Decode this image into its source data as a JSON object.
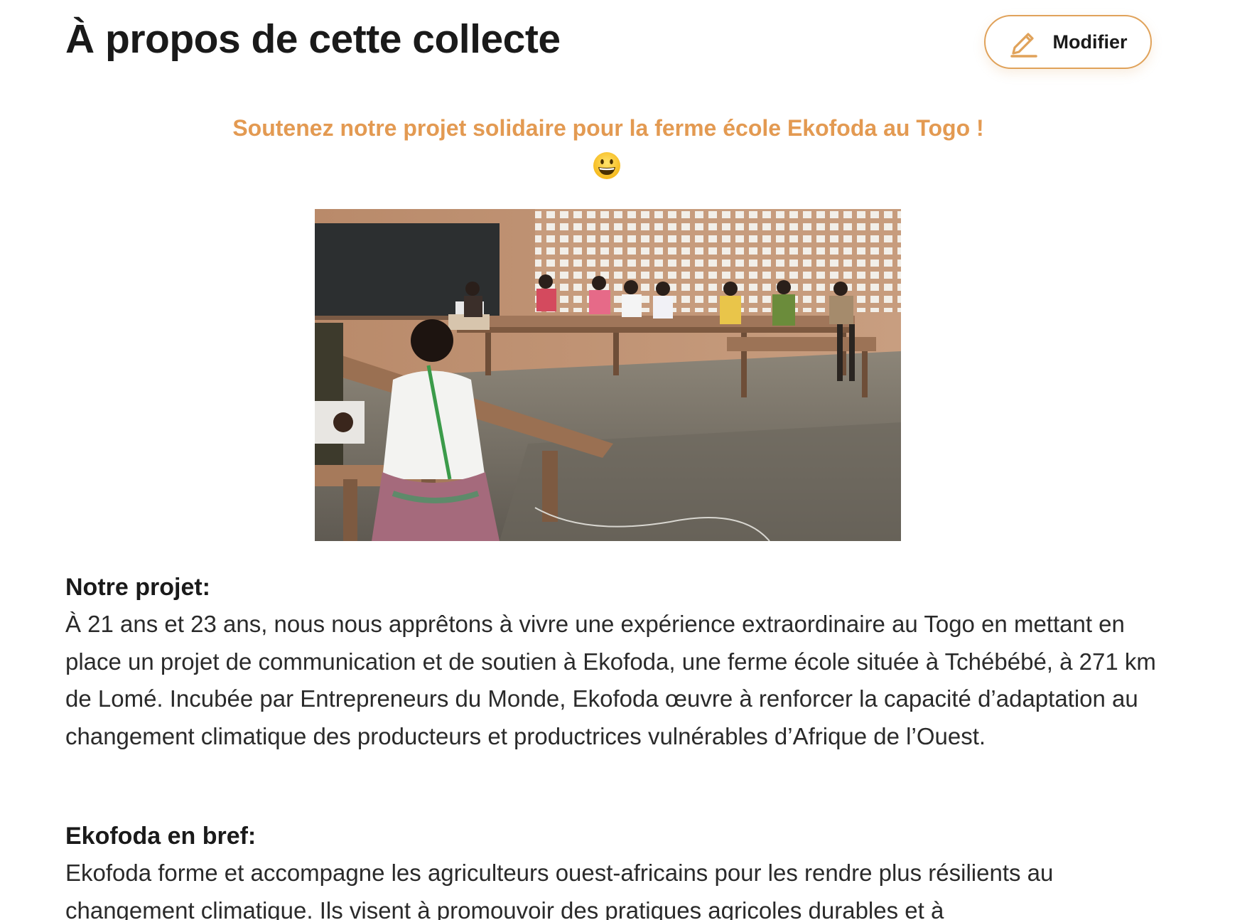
{
  "header": {
    "title": "À propos de cette collecte",
    "edit_label": "Modifier"
  },
  "tagline": "Soutenez notre projet solidaire pour la ferme école Ekofoda au Togo !",
  "icons": {
    "edit": "pencil-icon",
    "emoji": "grinning-face-emoji"
  },
  "photo": {
    "subject": "classroom-photo"
  },
  "sections": [
    {
      "heading": "Notre projet:",
      "body": "À 21 ans et 23 ans, nous nous apprêtons à vivre une expérience extraordinaire au Togo en mettant en place un projet de communication et de soutien à Ekofoda, une ferme école située à Tchébébé, à 271 km de Lomé. Incubée par Entrepreneurs du Monde, Ekofoda œuvre à renforcer la capacité d’adaptation au changement climatique des producteurs et productrices vulnérables d’Afrique de l’Ouest."
    },
    {
      "heading": "Ekofoda en bref:",
      "body": "Ekofoda forme et accompagne les agriculteurs ouest-africains pour les rendre plus résilients au changement climatique. Ils visent à promouvoir des pratiques agricoles durables et à"
    }
  ],
  "colors": {
    "accent": "#e39a52",
    "button_border": "#e0a25a",
    "text": "#1a1a1a"
  }
}
